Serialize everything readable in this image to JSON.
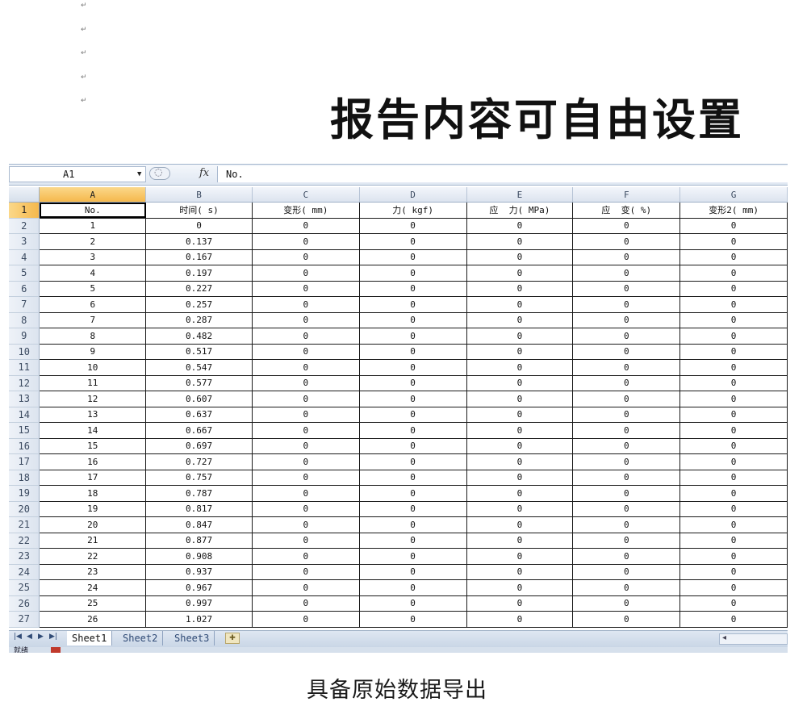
{
  "paragraph_mark": "↵",
  "headline": "报告内容可自由设置",
  "caption": "具备原始数据导出",
  "excel": {
    "name_box": "A1",
    "fx_symbol": "fx",
    "formula": "No.",
    "selected_cell": "A1",
    "columns": [
      "A",
      "B",
      "C",
      "D",
      "E",
      "F",
      "G"
    ],
    "header_row": [
      "No.",
      "时间( s)",
      "变形( mm)",
      "力( kgf)",
      "应  力( MPa)",
      "应  变( %)",
      "变形2( mm)"
    ],
    "rows": [
      [
        "1",
        "0",
        "0",
        "0",
        "0",
        "0",
        "0"
      ],
      [
        "2",
        "0.137",
        "0",
        "0",
        "0",
        "0",
        "0"
      ],
      [
        "3",
        "0.167",
        "0",
        "0",
        "0",
        "0",
        "0"
      ],
      [
        "4",
        "0.197",
        "0",
        "0",
        "0",
        "0",
        "0"
      ],
      [
        "5",
        "0.227",
        "0",
        "0",
        "0",
        "0",
        "0"
      ],
      [
        "6",
        "0.257",
        "0",
        "0",
        "0",
        "0",
        "0"
      ],
      [
        "7",
        "0.287",
        "0",
        "0",
        "0",
        "0",
        "0"
      ],
      [
        "8",
        "0.482",
        "0",
        "0",
        "0",
        "0",
        "0"
      ],
      [
        "9",
        "0.517",
        "0",
        "0",
        "0",
        "0",
        "0"
      ],
      [
        "10",
        "0.547",
        "0",
        "0",
        "0",
        "0",
        "0"
      ],
      [
        "11",
        "0.577",
        "0",
        "0",
        "0",
        "0",
        "0"
      ],
      [
        "12",
        "0.607",
        "0",
        "0",
        "0",
        "0",
        "0"
      ],
      [
        "13",
        "0.637",
        "0",
        "0",
        "0",
        "0",
        "0"
      ],
      [
        "14",
        "0.667",
        "0",
        "0",
        "0",
        "0",
        "0"
      ],
      [
        "15",
        "0.697",
        "0",
        "0",
        "0",
        "0",
        "0"
      ],
      [
        "16",
        "0.727",
        "0",
        "0",
        "0",
        "0",
        "0"
      ],
      [
        "17",
        "0.757",
        "0",
        "0",
        "0",
        "0",
        "0"
      ],
      [
        "18",
        "0.787",
        "0",
        "0",
        "0",
        "0",
        "0"
      ],
      [
        "19",
        "0.817",
        "0",
        "0",
        "0",
        "0",
        "0"
      ],
      [
        "20",
        "0.847",
        "0",
        "0",
        "0",
        "0",
        "0"
      ],
      [
        "21",
        "0.877",
        "0",
        "0",
        "0",
        "0",
        "0"
      ],
      [
        "22",
        "0.908",
        "0",
        "0",
        "0",
        "0",
        "0"
      ],
      [
        "23",
        "0.937",
        "0",
        "0",
        "0",
        "0",
        "0"
      ],
      [
        "24",
        "0.967",
        "0",
        "0",
        "0",
        "0",
        "0"
      ],
      [
        "25",
        "0.997",
        "0",
        "0",
        "0",
        "0",
        "0"
      ],
      [
        "26",
        "1.027",
        "0",
        "0",
        "0",
        "0",
        "0"
      ]
    ],
    "sheet_tabs": [
      "Sheet1",
      "Sheet2",
      "Sheet3"
    ],
    "active_sheet": "Sheet1",
    "status_text": "就绪",
    "icons": {
      "nav_first": "first-sheet-icon",
      "nav_prev": "prev-sheet-icon",
      "nav_next": "next-sheet-icon",
      "nav_last": "last-sheet-icon",
      "insert_sheet": "insert-sheet-icon",
      "fx": "function-icon",
      "dropdown": "chevron-down-icon"
    },
    "colors": {
      "selection_header": "#f5b84c",
      "header_bg": "#dce4ef",
      "grid_border": "#1a1a1a"
    }
  }
}
